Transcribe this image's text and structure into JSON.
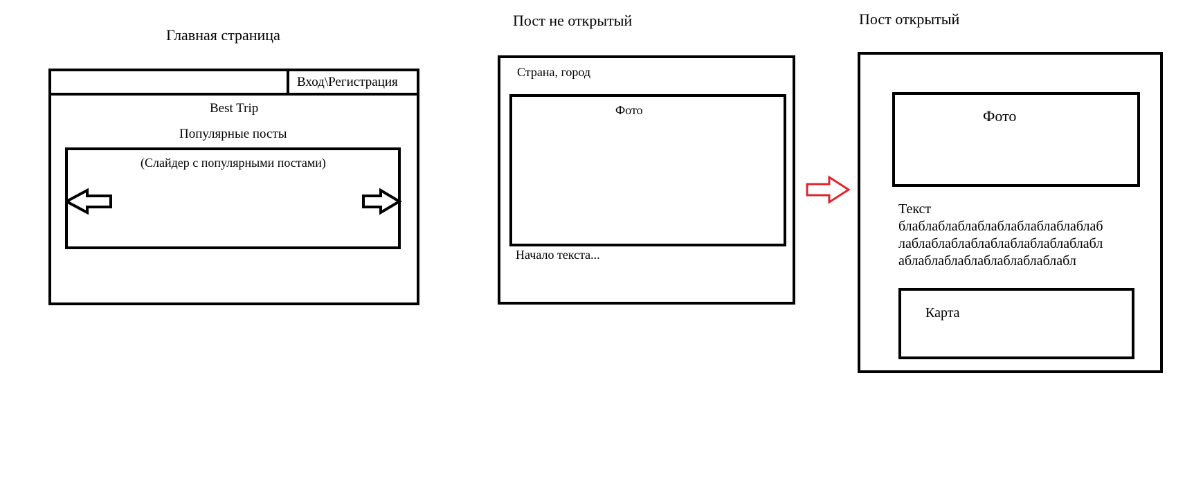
{
  "headings": {
    "main_page": "Главная страница",
    "post_closed": "Пост не открытый",
    "post_open": "Пост открытый"
  },
  "main_page": {
    "login_label": "Вход\\Регистрация",
    "site_title": "Best Trip",
    "popular_title": "Популярные посты",
    "slider_label": "(Слайдер с популярными постами)",
    "icons": [
      "arrow-left-icon",
      "arrow-right-icon"
    ]
  },
  "post_closed": {
    "location": "Страна, город",
    "photo_label": "Фото",
    "excerpt": "Начало текста..."
  },
  "transition": {
    "icon": "arrow-right-outline-icon",
    "color": "#e0252b"
  },
  "post_open": {
    "photo_label": "Фото",
    "text_lines": [
      "Текст",
      "блаблаблаблаблаблаблаблаблаблаб",
      "лаблаблаблаблаблаблаблаблаблабл",
      "аблаблаблаблаблаблаблаблабл"
    ],
    "map_label": "Карта"
  }
}
